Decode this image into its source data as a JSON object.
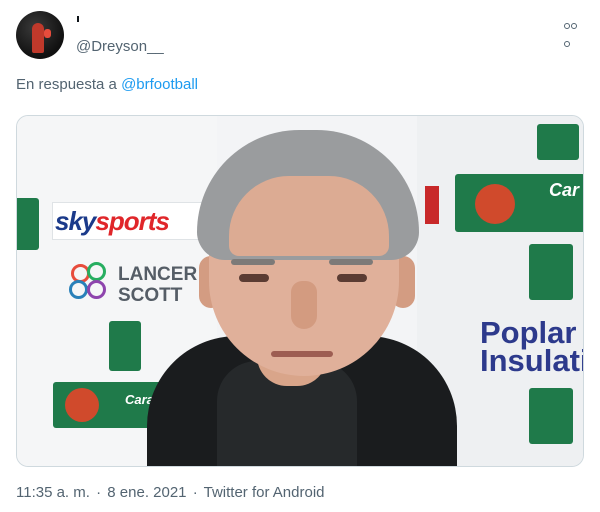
{
  "tweet": {
    "display_name": "'",
    "handle": "@Dreyson__",
    "reply_prefix": "En respuesta a",
    "reply_to": "@brfootball",
    "time": "11:35 a. m.",
    "separator": "·",
    "date": "8 ene. 2021",
    "client": "Twitter for Android"
  },
  "media": {
    "sponsor_sky": "sky",
    "sponsor_sports": "sports",
    "sponsor_lancer_line1": "LANCER",
    "sponsor_lancer_line2": "SCOTT",
    "sponsor_poplar_line1": "Poplar",
    "sponsor_poplar_line2": "Insulati",
    "sponsor_carabao_right": "Car",
    "sponsor_carabao_bottom": "Carat"
  },
  "colors": {
    "link": "#1d9bf0",
    "muted": "#536471",
    "board_green": "#1f7a4a"
  },
  "icons": {
    "more": "more-horizontal-icon"
  }
}
